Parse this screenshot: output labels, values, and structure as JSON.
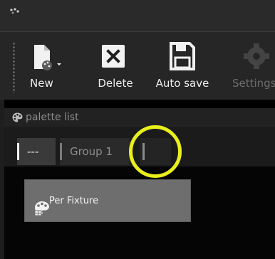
{
  "toolbar": {
    "new_label": "New",
    "delete_label": "Delete",
    "autosave_label": "Auto save",
    "settings_label": "Settings"
  },
  "palette_panel": {
    "title": "palette list",
    "tabs": [
      {
        "label": "---",
        "selected": true
      },
      {
        "label": "Group 1",
        "selected": false
      },
      {
        "label": "",
        "selected": false
      }
    ],
    "items": [
      {
        "label": "Per Fixture",
        "icon": "palette-fixture-icon"
      }
    ]
  },
  "highlight_color": "#e8ef1c"
}
